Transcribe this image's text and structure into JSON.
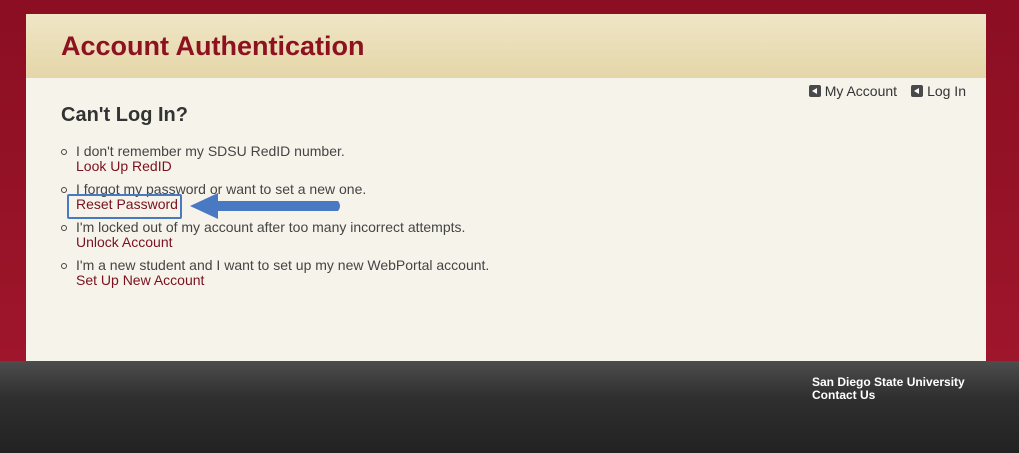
{
  "header": {
    "title": "Account Authentication"
  },
  "nav": {
    "my_account": "My Account",
    "log_in": "Log In"
  },
  "main": {
    "heading": "Can't Log In?",
    "items": [
      {
        "desc": "I don't remember my SDSU RedID number.",
        "link": "Look Up RedID"
      },
      {
        "desc": "I forgot my password or want to set a new one.",
        "link": "Reset Password"
      },
      {
        "desc": "I'm locked out of my account after too many incorrect attempts.",
        "link": "Unlock Account"
      },
      {
        "desc": "I'm a new student and I want to set up my new WebPortal account.",
        "link": "Set Up New Account"
      }
    ]
  },
  "footer": {
    "university": "San Diego State University",
    "contact": "Contact Us"
  },
  "colors": {
    "brand_red": "#8d1120",
    "link_red": "#7a1020",
    "highlight_blue": "#4a79c3"
  },
  "icons": {
    "nav": "left-arrow-icon",
    "annotation": "pointer-arrow-icon"
  }
}
